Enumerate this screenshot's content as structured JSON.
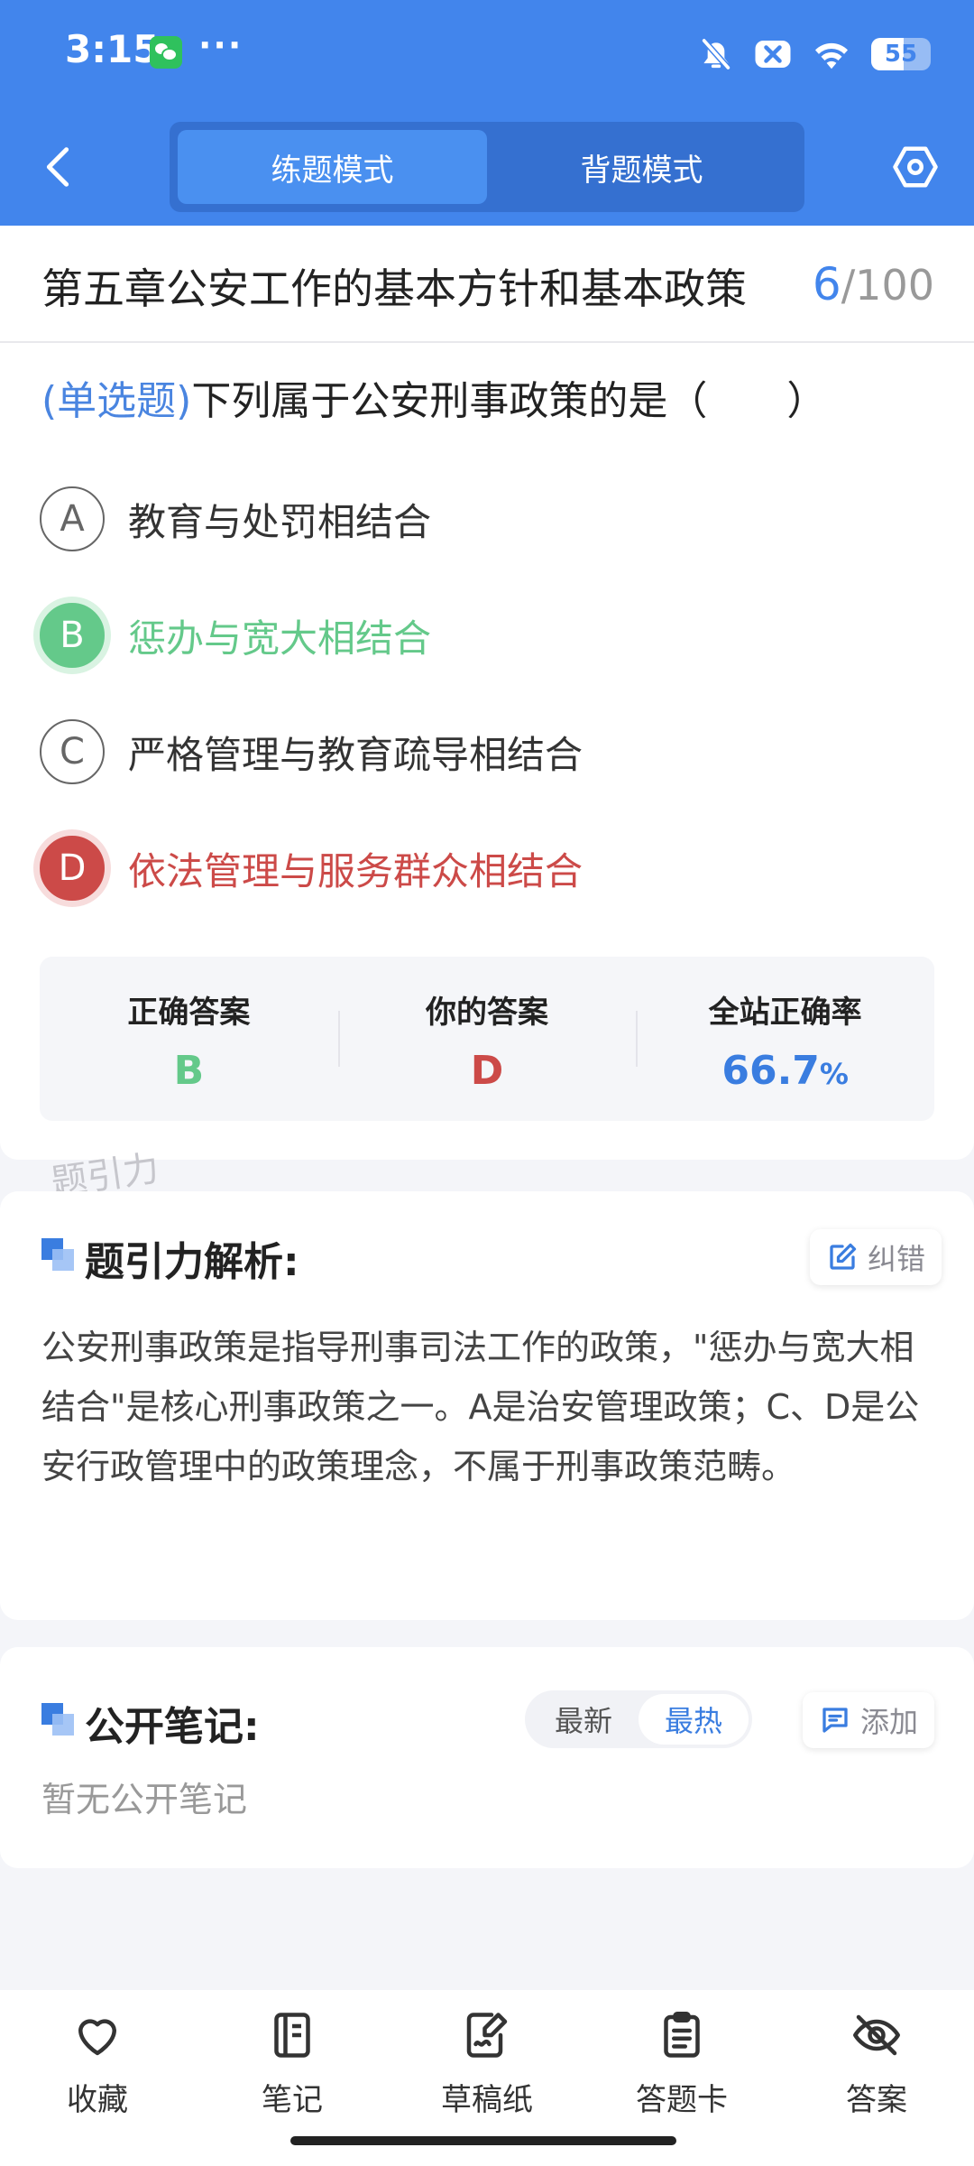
{
  "status_bar": {
    "time": "3:15",
    "more": "···",
    "battery": "55",
    "battery_fraction": 0.55
  },
  "header": {
    "modes": [
      "练题模式",
      "背题模式"
    ],
    "active_mode": 0
  },
  "question": {
    "chapter": "第五章公安工作的基本方针和基本政策",
    "current": "6",
    "total": "/100",
    "type_label": "(单选题)",
    "text": "下列属于公安刑事政策的是（　　）",
    "options": [
      {
        "letter": "A",
        "text": "教育与处罚相结合",
        "state": "normal"
      },
      {
        "letter": "B",
        "text": "惩办与宽大相结合",
        "state": "correct"
      },
      {
        "letter": "C",
        "text": "严格管理与教育疏导相结合",
        "state": "normal"
      },
      {
        "letter": "D",
        "text": "依法管理与服务群众相结合",
        "state": "wrong"
      }
    ]
  },
  "result": {
    "correct_label": "正确答案",
    "correct_value": "B",
    "yours_label": "你的答案",
    "yours_value": "D",
    "rate_label": "全站正确率",
    "rate_value": "66.7",
    "rate_unit": "%"
  },
  "watermark": "题引力",
  "analysis": {
    "title": "题引力解析:",
    "report_label": "纠错",
    "text": "公安刑事政策是指导刑事司法工作的政策，\"惩办与宽大相结合\"是核心刑事政策之一。A是治安管理政策；C、D是公安行政管理中的政策理念，不属于刑事政策范畴。"
  },
  "notes": {
    "title": "公开笔记:",
    "sort_options": [
      "最新",
      "最热"
    ],
    "active_sort": 1,
    "add_label": "添加",
    "empty": "暂无公开笔记"
  },
  "bottom_nav": [
    {
      "label": "收藏",
      "icon": "heart-icon"
    },
    {
      "label": "笔记",
      "icon": "notebook-icon"
    },
    {
      "label": "草稿纸",
      "icon": "draft-icon"
    },
    {
      "label": "答题卡",
      "icon": "answer-card-icon"
    },
    {
      "label": "答案",
      "icon": "eye-off-icon"
    }
  ],
  "colors": {
    "primary": "#4285ec",
    "correct": "#64c98a",
    "wrong": "#cc4a48"
  }
}
